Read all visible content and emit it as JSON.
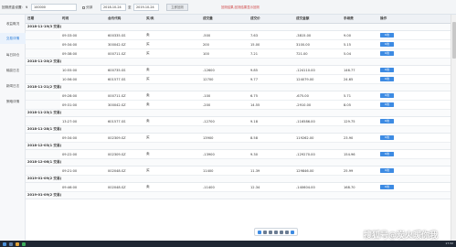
{
  "toolbar": {
    "initial_fund_label": "回测资金设置:",
    "currency_symbol": "¥",
    "initial_fund_value": "100000",
    "stock_label": "分钟",
    "start_date": "2018-10-24",
    "separator": "至",
    "end_date": "2019-10-24",
    "apply_button": "立即回测",
    "note": "回测结果,回测结果显示回测"
  },
  "sidebar": {
    "items": [
      {
        "label": "收益概况"
      },
      {
        "label": "交易详情"
      },
      {
        "label": "每日持仓"
      },
      {
        "label": "输赢日志"
      },
      {
        "label": "新闻日志"
      },
      {
        "label": "策略详情"
      }
    ]
  },
  "table": {
    "headers": [
      "日期",
      "时间",
      "合约代码",
      "买/卖",
      "成交量",
      "成交价",
      "成交金额",
      "手续费",
      "操作"
    ],
    "action_label": "K线",
    "groups": [
      {
        "date": "2018-11-19(3 交易)",
        "rows": [
          [
            "09:33:00",
            "600335.SS",
            "卖",
            "-500",
            "7.63",
            "-3815.00",
            "9.00"
          ],
          [
            "09:34:00",
            "300042.SZ",
            "买",
            "200",
            "15.00",
            "3100.00",
            "5.15"
          ],
          [
            "09:38:00",
            "000711.SZ",
            "买",
            "100",
            "7.21",
            "721.00",
            "5.04"
          ]
        ]
      },
      {
        "date": "2018-11-20(2 交易)",
        "rows": [
          [
            "10:55:00",
            "600735.SS",
            "卖",
            "-12600",
            "9.85",
            "-124110.00",
            "146.77"
          ],
          [
            "10:56:00",
            "601577.SS",
            "买",
            "12700",
            "9.77",
            "124079.00",
            "24.65"
          ]
        ]
      },
      {
        "date": "2018-11-21(2 交易)",
        "rows": [
          [
            "09:28:00",
            "000711.SZ",
            "卖",
            "-100",
            "6.75",
            "-675.00",
            "5.71"
          ],
          [
            "09:31:00",
            "300042.SZ",
            "卖",
            "-200",
            "14.55",
            "-2910.00",
            "8.05"
          ]
        ]
      },
      {
        "date": "2018-11-23(1 交易)",
        "rows": [
          [
            "13:27:00",
            "601577.SS",
            "卖",
            "-12700",
            "9.18",
            "-116586.00",
            "129.75"
          ]
        ]
      },
      {
        "date": "2018-11-28(1 交易)",
        "rows": [
          [
            "09:34:00",
            "002309.SZ",
            "买",
            "13900",
            "8.58",
            "119262.00",
            "23.90"
          ]
        ]
      },
      {
        "date": "2018-12-03(1 交易)",
        "rows": [
          [
            "09:22:00",
            "002309.SZ",
            "卖",
            "-13900",
            "9.30",
            "-129270.00",
            "154.96"
          ]
        ]
      },
      {
        "date": "2018-12-06(1 交易)",
        "rows": [
          [
            "09:21:00",
            "002048.SZ",
            "买",
            "11400",
            "11.39",
            "129846.00",
            "25.99"
          ]
        ]
      },
      {
        "date": "2019-01-09(2 交易)",
        "rows": [
          [
            "09:46:00",
            "002048.SZ",
            "卖",
            "-11400",
            "12.34",
            "-140604.00",
            "168.70"
          ]
        ]
      },
      {
        "date": "2019-01-09(2 交易)",
        "rows": []
      }
    ]
  },
  "taskbar": {
    "clock": "17:32"
  },
  "watermark": "搜狐号@炭火暖你我",
  "colors": {
    "accent": "#3d8be3",
    "note_red": "#d04848",
    "taskbar": "#1f2733"
  }
}
